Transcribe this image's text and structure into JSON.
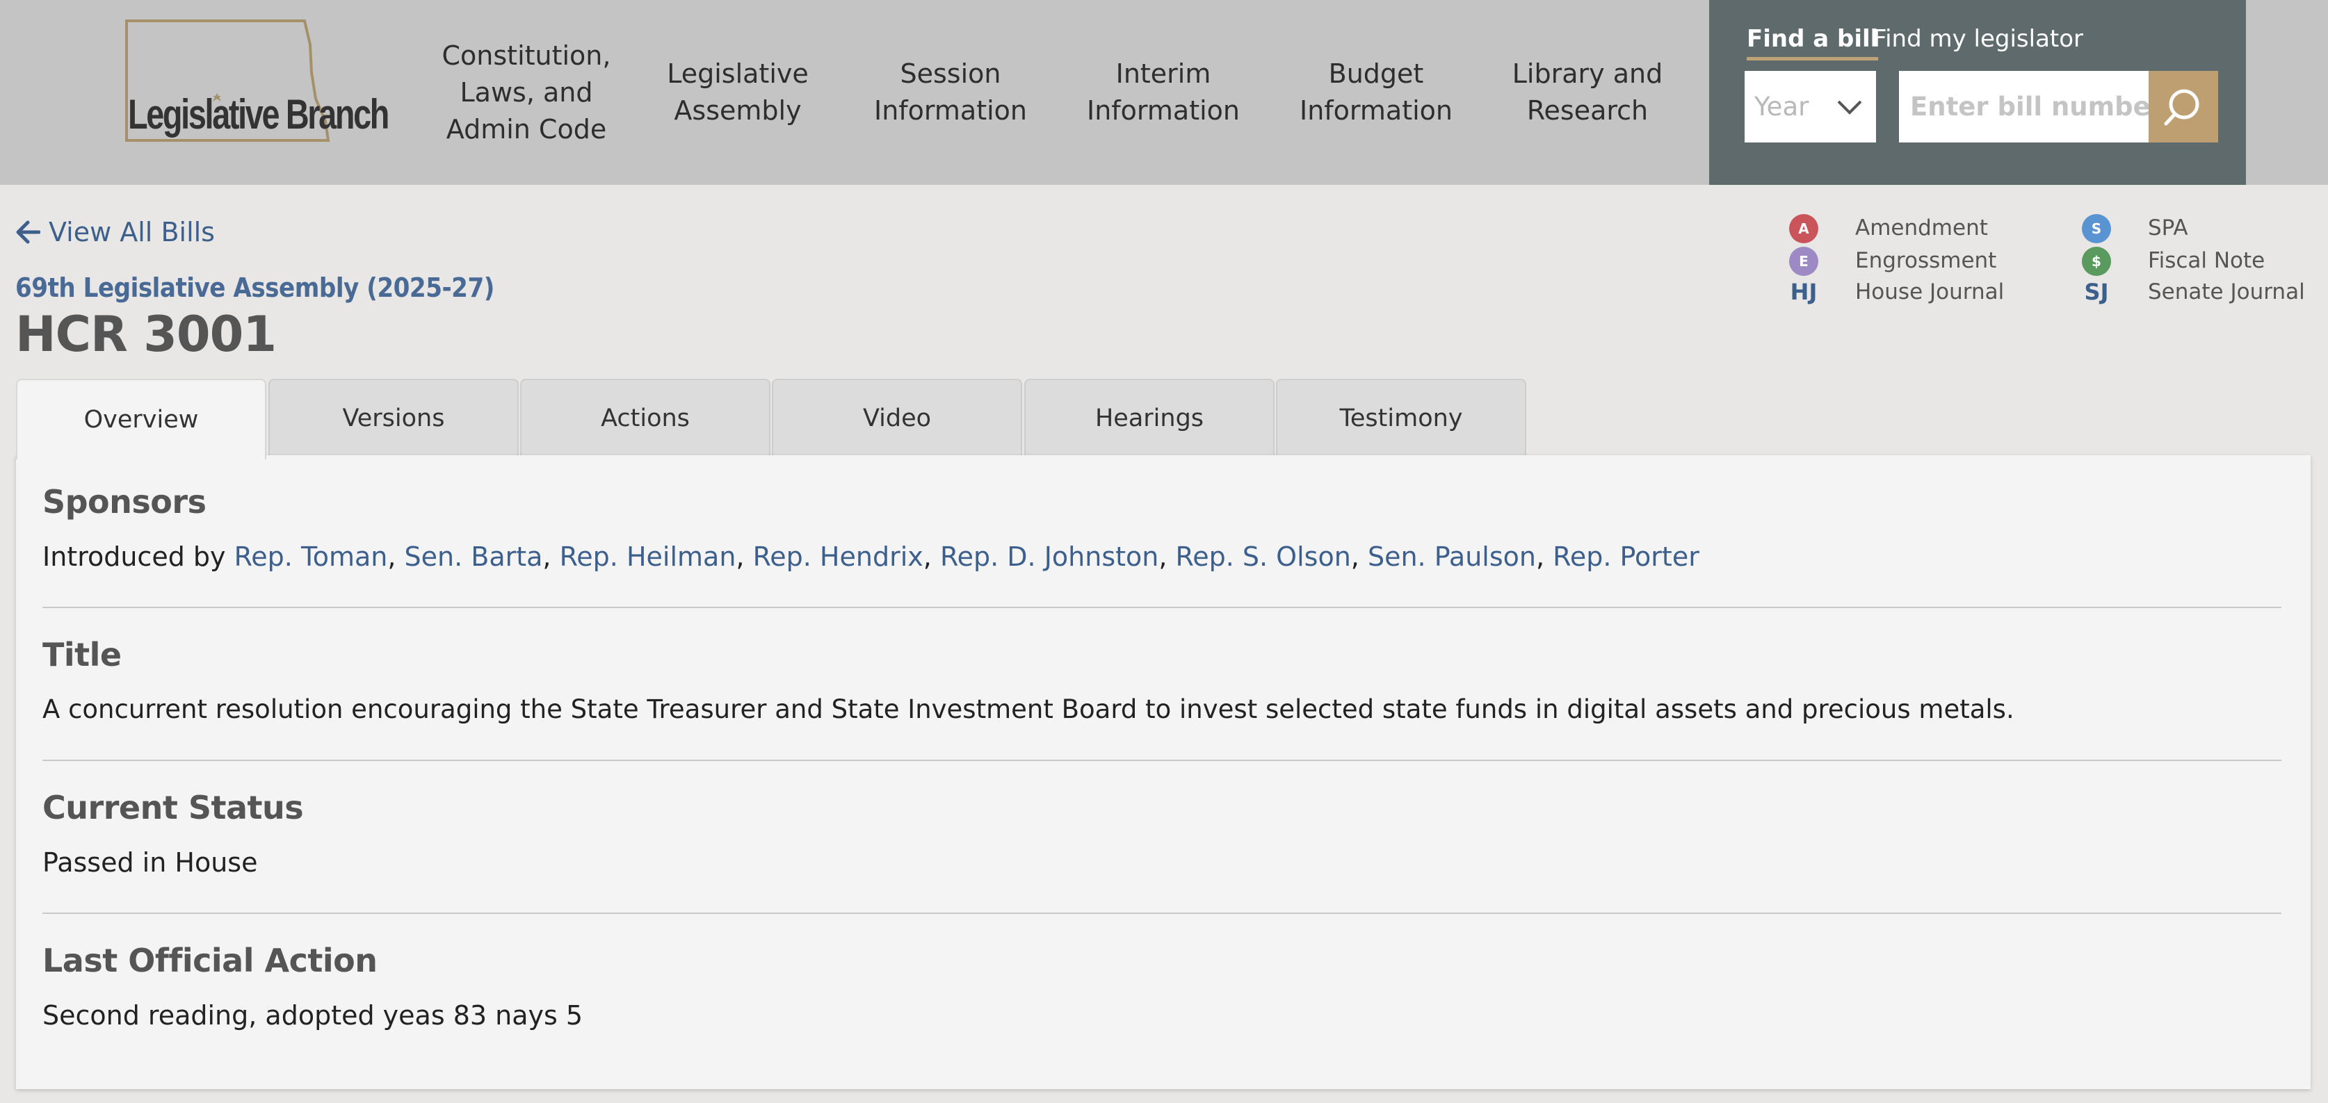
{
  "logo": {
    "text": "Legislative Branch"
  },
  "nav": [
    {
      "label": "Constitution,\nLaws, and\nAdmin Code"
    },
    {
      "label": "Legislative\nAssembly"
    },
    {
      "label": "Session\nInformation"
    },
    {
      "label": "Interim\nInformation"
    },
    {
      "label": "Budget\nInformation"
    },
    {
      "label": "Library and\nResearch"
    }
  ],
  "finder": {
    "tab_find": "Find a bill",
    "tab_legislator": "Find my legislator",
    "year_placeholder": "Year",
    "bill_placeholder": "Enter bill number"
  },
  "page": {
    "back_link": "View All Bills",
    "assembly": "69th Legislative Assembly (2025-27)",
    "bill": "HCR 3001"
  },
  "legend": [
    {
      "icon": "A",
      "label": "Amendment",
      "color": "#c9545a"
    },
    {
      "icon": "S",
      "label": "SPA",
      "color": "#5a93d1"
    },
    {
      "icon": "E",
      "label": "Engrossment",
      "color": "#9d8ac4"
    },
    {
      "icon": "$",
      "label": "Fiscal Note",
      "color": "#5a9a5e"
    },
    {
      "icon": "HJ",
      "label": "House Journal"
    },
    {
      "icon": "SJ",
      "label": "Senate Journal"
    }
  ],
  "tabs": [
    "Overview",
    "Versions",
    "Actions",
    "Video",
    "Hearings",
    "Testimony"
  ],
  "sponsors": {
    "heading": "Sponsors",
    "intro": "Introduced by ",
    "names": [
      "Rep. Toman",
      "Sen. Barta",
      "Rep. Heilman",
      "Rep. Hendrix",
      "Rep. D. Johnston",
      "Rep. S. Olson",
      "Sen. Paulson",
      "Rep. Porter"
    ],
    "separator": ", "
  },
  "title": {
    "heading": "Title",
    "text": "A concurrent resolution encouraging the State Treasurer and State Investment Board to invest selected state funds in digital assets and precious metals."
  },
  "status": {
    "heading": "Current Status",
    "text": "Passed in House"
  },
  "last_action": {
    "heading": "Last Official Action",
    "text": "Second reading, adopted yeas 83 nays 5"
  }
}
